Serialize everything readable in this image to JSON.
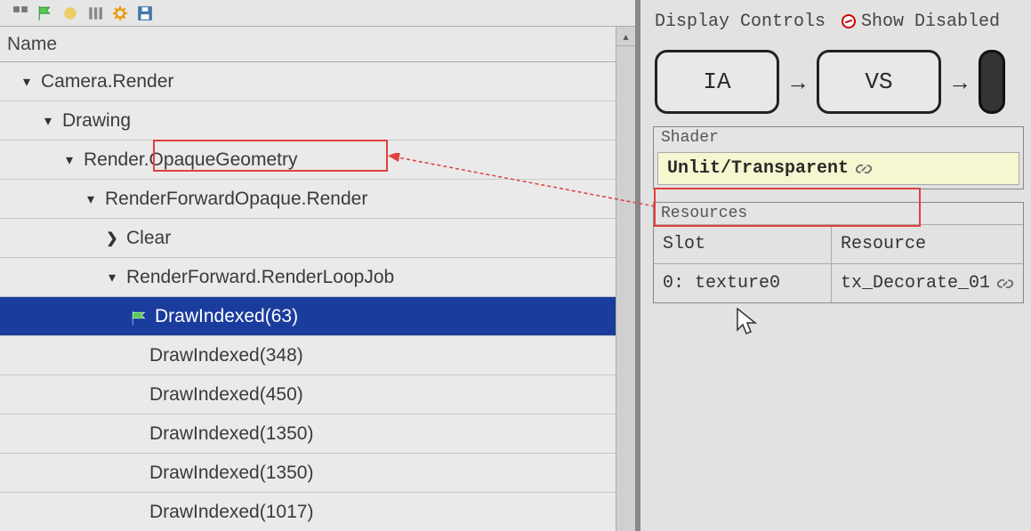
{
  "left": {
    "header": "Name",
    "tree": [
      {
        "label": "Camera.Render",
        "indent": 20,
        "expanded": true,
        "chev": "down"
      },
      {
        "label": "Drawing",
        "indent": 44,
        "expanded": true,
        "chev": "down"
      },
      {
        "label": "Render.OpaqueGeometry",
        "indent": 68,
        "expanded": true,
        "chev": "down"
      },
      {
        "label": "RenderForwardOpaque.Render",
        "indent": 92,
        "expanded": true,
        "chev": "down"
      },
      {
        "label": "Clear",
        "indent": 116,
        "expanded": false,
        "chev": "right"
      },
      {
        "label": "RenderForward.RenderLoopJob",
        "indent": 116,
        "expanded": true,
        "chev": "down"
      },
      {
        "label": "DrawIndexed(63)",
        "indent": 200,
        "selected": true,
        "flag": true
      },
      {
        "label": "DrawIndexed(348)",
        "indent": 168
      },
      {
        "label": "DrawIndexed(450)",
        "indent": 168
      },
      {
        "label": "DrawIndexed(1350)",
        "indent": 168
      },
      {
        "label": "DrawIndexed(1350)",
        "indent": 168
      },
      {
        "label": "DrawIndexed(1017)",
        "indent": 168
      }
    ]
  },
  "right": {
    "tabs": {
      "display_controls": "Display Controls",
      "show_disabled": "Show Disabled"
    },
    "pipeline": {
      "ia": "IA",
      "vs": "VS"
    },
    "shader_group": "Shader",
    "shader_value": "Unlit/Transparent",
    "resources_group": "Resources",
    "res_head": {
      "slot": "Slot",
      "resource": "Resource"
    },
    "res_row": {
      "slot": "0: texture0",
      "resource": "tx_Decorate_01"
    }
  }
}
